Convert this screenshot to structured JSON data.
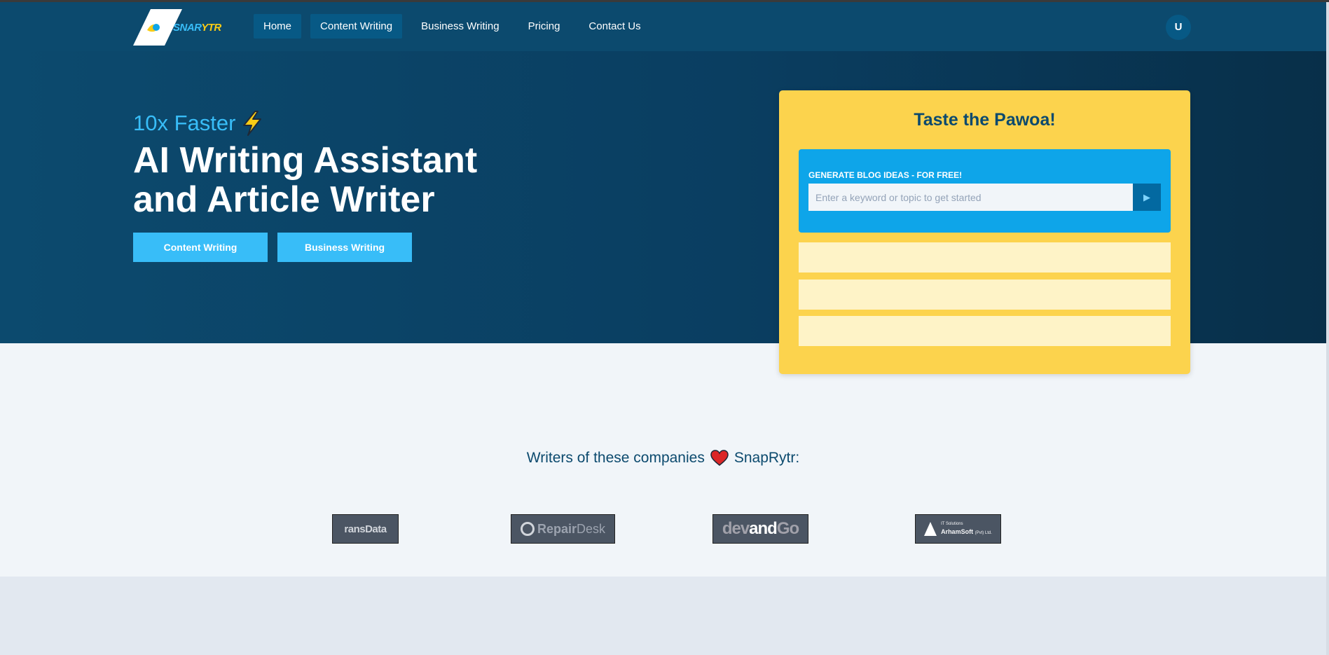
{
  "brand": {
    "logo_text_part1": "SNAR",
    "logo_text_part2": "YTR",
    "accent_color": "#38bdf8",
    "primary_color": "#0c4a6e",
    "card_color": "#fcd34d"
  },
  "nav": {
    "items": [
      {
        "label": "Home",
        "active": true
      },
      {
        "label": "Content Writing",
        "active": true
      },
      {
        "label": "Business Writing",
        "active": false
      },
      {
        "label": "Pricing",
        "active": false
      },
      {
        "label": "Contact Us",
        "active": false
      }
    ],
    "avatar_initial": "U"
  },
  "hero": {
    "tagline": "10x Faster",
    "tagline_icon": "lightning-icon",
    "headline": "AI Writing Assistant and Article Writer",
    "buttons": [
      "Content Writing",
      "Business Writing"
    ]
  },
  "generator": {
    "title": "Taste the Pawoa!",
    "label": "GENERATE BLOG IDEAS - FOR FREE!",
    "placeholder": "Enter a keyword or topic to get started",
    "submit_icon": "play-icon"
  },
  "companies": {
    "title_before": "Writers of these companies",
    "title_icon": "heart-icon",
    "title_after": "SnapRytr:",
    "logos": {
      "transdata": "ransData",
      "repairdesk_a": "Repair",
      "repairdesk_b": "Desk",
      "devandgo_a": "dev",
      "devandgo_b": "and",
      "devandgo_c": "Go",
      "arhamsoft_small": "IT Solutions",
      "arhamsoft_name": "ArhamSoft",
      "arhamsoft_suffix": "(Pvt) Ltd."
    }
  }
}
